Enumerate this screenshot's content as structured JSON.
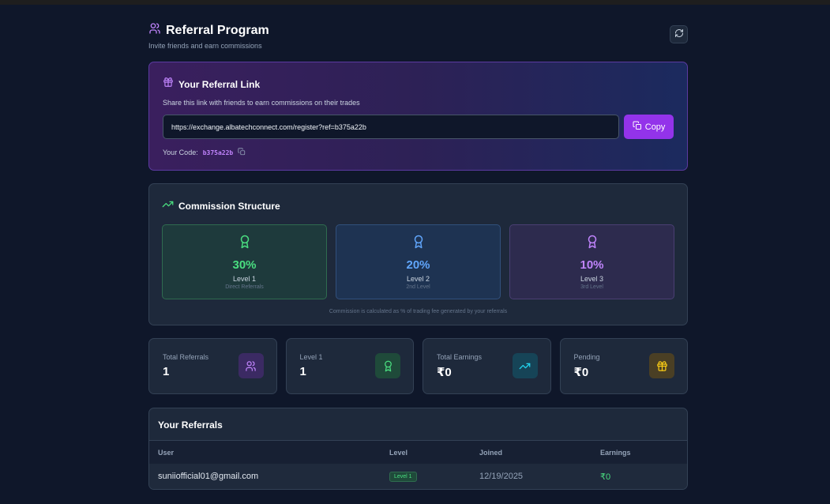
{
  "header": {
    "title": "Referral Program",
    "subtitle": "Invite friends and earn commissions"
  },
  "referral_link": {
    "title": "Your Referral Link",
    "description": "Share this link with friends to earn commissions on their trades",
    "url": "https://exchange.albatechconnect.com/register?ref=b375a22b",
    "copy_label": "Copy",
    "code_label": "Your Code:",
    "code": "b375a22b"
  },
  "commission": {
    "title": "Commission Structure",
    "levels": [
      {
        "percent": "30%",
        "name": "Level 1",
        "sub": "Direct Referrals",
        "color": "#4ade80"
      },
      {
        "percent": "20%",
        "name": "Level 2",
        "sub": "2nd Level",
        "color": "#60a5fa"
      },
      {
        "percent": "10%",
        "name": "Level 3",
        "sub": "3rd Level",
        "color": "#c084fc"
      }
    ],
    "note": "Commission is calculated as % of trading fee generated by your referrals"
  },
  "stats": [
    {
      "label": "Total Referrals",
      "value": "1",
      "icon": "users-icon",
      "icon_bg": "#3b2a63",
      "icon_color": "#c084fc"
    },
    {
      "label": "Level 1",
      "value": "1",
      "icon": "award-icon",
      "icon_bg": "#1f4a3a",
      "icon_color": "#4ade80"
    },
    {
      "label": "Total Earnings",
      "value": "₹0",
      "icon": "trending-up-icon",
      "icon_bg": "#164457",
      "icon_color": "#22d3ee"
    },
    {
      "label": "Pending",
      "value": "₹0",
      "icon": "gift-icon",
      "icon_bg": "#4a3f24",
      "icon_color": "#facc15"
    }
  ],
  "referrals": {
    "title": "Your Referrals",
    "columns": [
      "User",
      "Level",
      "Joined",
      "Earnings"
    ],
    "rows": [
      {
        "user": "suniiofficial01@gmail.com",
        "level": "Level 1",
        "joined": "12/19/2025",
        "earnings": "₹0"
      }
    ]
  }
}
